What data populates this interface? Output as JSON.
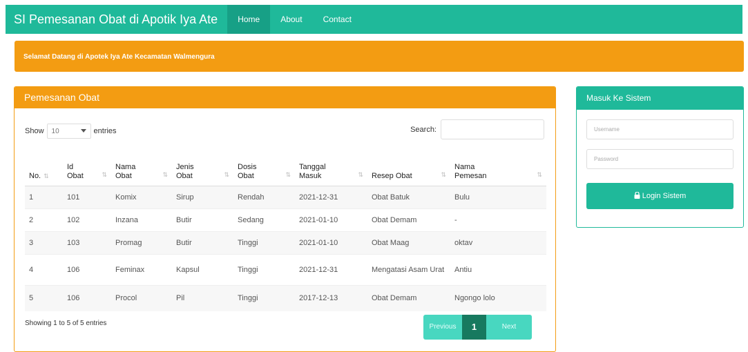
{
  "navbar": {
    "brand": "SI Pemesanan Obat di Apotik Iya Ate",
    "items": [
      {
        "label": "Home",
        "active": true
      },
      {
        "label": "About",
        "active": false
      },
      {
        "label": "Contact",
        "active": false
      }
    ]
  },
  "welcome": "Selamat Datang di Apotek Iya Ate Kecamatan Walmengura",
  "orders_panel": {
    "title": "Pemesanan Obat",
    "length": {
      "show": "Show",
      "value": "10",
      "entries": "entries"
    },
    "search_label": "Search:",
    "columns": [
      "No.",
      "Id Obat",
      "Nama Obat",
      "Jenis Obat",
      "Dosis Obat",
      "Tanggal Masuk",
      "Resep Obat",
      "Nama Pemesan"
    ],
    "rows": [
      [
        "1",
        "101",
        "Komix",
        "Sirup",
        "Rendah",
        "2021-12-31",
        "Obat Batuk",
        "Bulu"
      ],
      [
        "2",
        "102",
        "Inzana",
        "Butir",
        "Sedang",
        "2021-01-10",
        "Obat Demam",
        "-"
      ],
      [
        "3",
        "103",
        "Promag",
        "Butir",
        "Tinggi",
        "2021-01-10",
        "Obat Maag",
        "oktav"
      ],
      [
        "4",
        "106",
        "Feminax",
        "Kapsul",
        "Tinggi",
        "2021-12-31",
        "Mengatasi Asam Urat",
        "Antiu"
      ],
      [
        "5",
        "106",
        "Procol",
        "Pil",
        "Tinggi",
        "2017-12-13",
        "Obat Demam",
        "Ngongo lolo"
      ]
    ],
    "info": "Showing 1 to 5 of 5 entries",
    "pagination": {
      "previous": "Previous",
      "current": "1",
      "next": "Next"
    }
  },
  "login_panel": {
    "title": "Masuk Ke Sistem",
    "username_placeholder": "Username",
    "password_placeholder": "Password",
    "button_label": "Login Sistem"
  },
  "colors": {
    "green": "#1fb99a",
    "orange": "#f39c12",
    "teal_active": "#17795f"
  },
  "icons": {
    "sort": "sort-arrows-icon",
    "lock": "lock-icon",
    "dropdown": "chevron-down-icon"
  }
}
